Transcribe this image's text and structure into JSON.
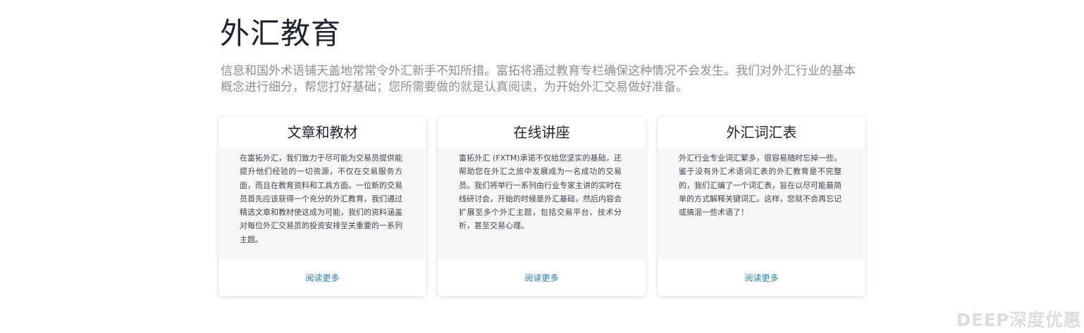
{
  "section": {
    "title": "外汇教育",
    "description": "信息和国外术语铺天盖地常常令外汇新手不知所措。富拓将通过教育专栏确保这种情况不会发生。我们对外汇行业的基本概念进行细分，帮您打好基础；您所需要做的就是认真阅读，为开始外汇交易做好准备。"
  },
  "cards": [
    {
      "title": "文章和教材",
      "body": "在富拓外汇，我们致力于尽可能为交易员提供能提升他们经验的一切资源，不仅在交易服务方面，而且在教育资料和工具方面。一位新的交易员首先应该获得一个充分的外汇教育，我们通过精选文章和教材使这成为可能，我们的资料涵盖对每位外汇交易员的投资安排至关重要的一系列主题。",
      "link": "阅读更多"
    },
    {
      "title": "在线讲座",
      "body": "富拓外汇 (FXTM)承诺不仅给您坚实的基础，还帮助您在外汇之旅中发展成为一名成功的交易员。我们将举行一系列由行业专家主讲的实时在线研讨会，开始的时候是外汇基础，然后内容会扩展至多个外汇主题，包括交易平台、技术分析，甚至交易心理。",
      "link": "阅读更多"
    },
    {
      "title": "外汇词汇表",
      "body": "外汇行业专业词汇繁多，很容易随时忘掉一些。鉴于没有外汇术语词汇表的外汇教育是不完整的，我们汇编了一个词汇表，旨在以尽可能最简单的方式解释关键词汇。这样，您就不会再忘记或搞混一些术语了！",
      "link": "阅读更多"
    }
  ],
  "watermark": "DEEP深度优惠",
  "colors": {
    "title": "#1f2430",
    "subtitle": "#8a8f98",
    "body_text": "#3f4550",
    "link": "#2b7fb8",
    "card_body_bg": "#f7f7f7",
    "watermark": "#dddddd"
  }
}
